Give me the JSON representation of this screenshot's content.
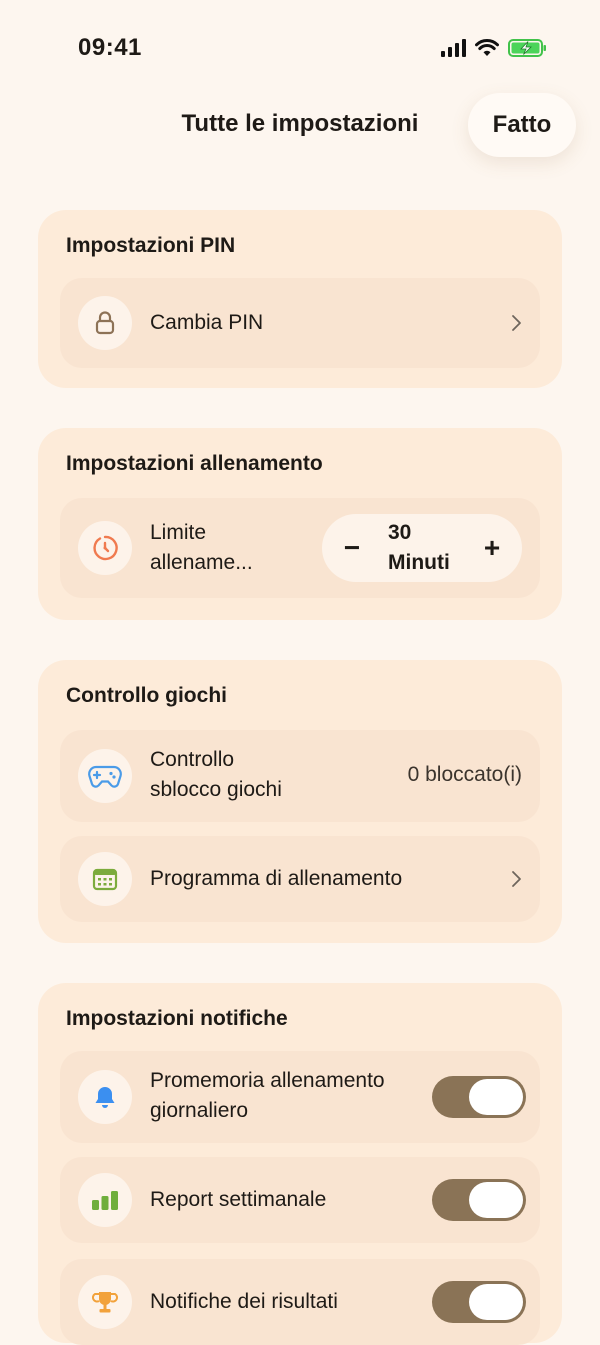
{
  "status_bar": {
    "time": "09:41"
  },
  "nav": {
    "title": "Tutte le impostazioni",
    "done_label": "Fatto"
  },
  "pin_section": {
    "title": "Impostazioni PIN",
    "change_pin": {
      "label": "Cambia PIN",
      "icon": "lock-icon"
    }
  },
  "training_section": {
    "title": "Impostazioni allenamento",
    "limit": {
      "label_line1": "Limite",
      "label_line2": "allename...",
      "value_line1": "30",
      "value_line2": "Minuti",
      "minus": "−",
      "plus": "+",
      "icon": "timer-icon"
    }
  },
  "games_section": {
    "title": "Controllo giochi",
    "unlock": {
      "label_line1": "Controllo",
      "label_line2": "sblocco giochi",
      "value": "0 bloccato(i)",
      "icon": "gamepad-icon"
    },
    "schedule": {
      "label": "Programma di allenamento",
      "icon": "calendar-icon"
    }
  },
  "notifications_section": {
    "title": "Impostazioni notifiche",
    "daily_reminder": {
      "label_line1": "Promemoria allenamento",
      "label_line2": "giornaliero",
      "icon": "bell-icon",
      "enabled": true
    },
    "weekly_report": {
      "label": "Report settimanale",
      "icon": "bar-chart-icon",
      "enabled": true
    },
    "achievements": {
      "label": "Notifiche dei risultati",
      "icon": "trophy-icon",
      "enabled": true
    }
  },
  "colors": {
    "background": "#fdf6ef",
    "card": "#fdebd9",
    "row": "#f9e4d1",
    "toggle_on": "#8a7356",
    "timer_accent": "#f07a4f",
    "gamepad_accent": "#4a9be8",
    "calendar_accent": "#7cab3c",
    "bell_accent": "#3b8ff0",
    "chart_accent": "#6fae3c",
    "trophy_accent": "#f2a23b"
  }
}
